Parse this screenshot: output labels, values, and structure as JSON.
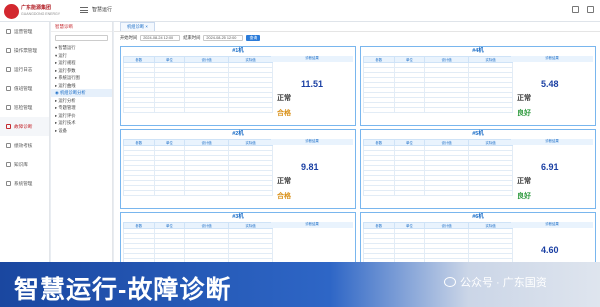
{
  "header": {
    "logo_title": "广东能源集团",
    "logo_subtitle": "GUANGDONG ENERGY",
    "page_title": "智慧运行"
  },
  "sidebar": {
    "items": [
      {
        "label": "运营管理",
        "icon": "dashboard-icon"
      },
      {
        "label": "操作票管理",
        "icon": "ticket-icon"
      },
      {
        "label": "运行日志",
        "icon": "log-icon"
      },
      {
        "label": "值班管理",
        "icon": "calendar-icon"
      },
      {
        "label": "巡检管理",
        "icon": "inspect-icon"
      },
      {
        "label": "故障诊断",
        "icon": "diagnosis-icon"
      },
      {
        "label": "绩效考核",
        "icon": "chart-icon"
      },
      {
        "label": "知识库",
        "icon": "book-icon"
      },
      {
        "label": "系统管理",
        "icon": "gear-icon"
      }
    ],
    "active_index": 5
  },
  "tree": {
    "header": "智慧诊断",
    "nodes": [
      "▾ 智慧运行",
      "  ▾ 运行",
      "    ▸ 运行规程",
      "    ▸ 运行参数",
      "    ▸ 系统运行图",
      "    ▸ 运行曲线",
      "    ◉ 机组诊断分析",
      "  ▸ 运行分析",
      "  ▸ 专题管理",
      "  ▸ 运行评价",
      "  ▸ 运行技术",
      "▸ 设备"
    ],
    "selected_index": 6
  },
  "tabs": [
    {
      "label": "机组诊断 ×"
    }
  ],
  "filters": {
    "start_label": "开始时间",
    "start_value": "2024-08-24 12:00",
    "end_label": "结束时间",
    "end_value": "2024-08-25 12:00",
    "button": "查询"
  },
  "units": [
    {
      "title": "#1机",
      "metric": "11.51",
      "status1": "正常",
      "status2": "合格",
      "status2_good": false
    },
    {
      "title": "#4机",
      "metric": "5.48",
      "status1": "正常",
      "status2": "良好",
      "status2_good": true
    },
    {
      "title": "#2机",
      "metric": "9.81",
      "status1": "正常",
      "status2": "合格",
      "status2_good": false
    },
    {
      "title": "#5机",
      "metric": "6.91",
      "status1": "正常",
      "status2": "良好",
      "status2_good": true
    },
    {
      "title": "#3机",
      "metric": "",
      "status1": "",
      "status2": "",
      "status2_good": false
    },
    {
      "title": "#6机",
      "metric": "4.60",
      "status1": "",
      "status2": "",
      "status2_good": false
    }
  ],
  "table_headers": [
    "参数",
    "单位",
    "设计值",
    "实际值"
  ],
  "side_header": "诊断结果",
  "banner": {
    "text": "智慧运行-故障诊断",
    "watermark": "公众号 · 广东国资"
  }
}
